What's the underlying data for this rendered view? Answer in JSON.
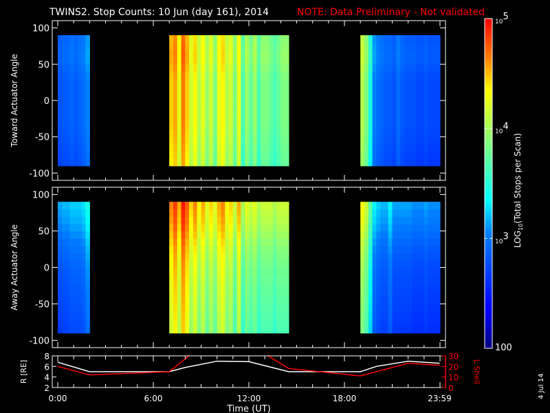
{
  "title": "TWINS2. Stop Counts: 10 Jun (day 161), 2014",
  "note": "NOTE: Data Preliminary - Not validated",
  "date_stamp": "4 Jul 14",
  "colors": {
    "note": "#ff0000",
    "axis": "#ffffff",
    "lshell": "#ff0000",
    "radius": "#ffffff"
  },
  "chart_data": [
    {
      "type": "heatmap",
      "name": "toward",
      "ylabel": "Toward Actuator Angle",
      "ylim": [
        -110,
        110
      ],
      "yticks": [
        "100",
        "50",
        "0",
        "-50",
        "-100"
      ],
      "ytick_values": [
        100,
        50,
        0,
        -50,
        -100
      ],
      "angle_range": [
        -90,
        90
      ],
      "xlim_hours": [
        0,
        24
      ],
      "segments": [
        {
          "start": 0.0,
          "step": 0.25,
          "log10_counts": [
            2.85,
            2.9,
            2.9,
            2.95,
            2.9,
            2.95,
            3.0,
            3.1
          ]
        },
        {
          "start": 7.0,
          "step": 0.25,
          "log10_counts": [
            4.5,
            4.6,
            4.3,
            4.7,
            4.5,
            4.2,
            4.4,
            4.1,
            4.3,
            4.0,
            4.2,
            3.9,
            4.3,
            4.4,
            4.1,
            4.2,
            3.9,
            4.3,
            3.7,
            4.0,
            3.8,
            4.0,
            3.7,
            3.9,
            3.9,
            3.8,
            3.7,
            3.8,
            3.9,
            3.9
          ]
        },
        {
          "start": 19.0,
          "step": 0.25,
          "log10_counts": [
            4.1,
            3.9,
            3.5,
            3.1,
            3.0,
            2.95,
            2.9,
            2.9,
            2.85,
            3.0,
            2.9,
            2.85,
            2.85,
            2.85,
            2.8,
            2.8,
            2.85,
            2.8,
            2.8,
            2.8
          ]
        }
      ],
      "angle_modifier": {
        "angles": [
          -90,
          -60,
          -30,
          0,
          30,
          60,
          90
        ],
        "delta_log10": [
          -0.15,
          -0.1,
          -0.05,
          -0.05,
          -0.05,
          0.05,
          0.0
        ]
      }
    },
    {
      "type": "heatmap",
      "name": "away",
      "ylabel": "Away Actuator Angle",
      "ylim": [
        -110,
        110
      ],
      "yticks": [
        "100",
        "50",
        "0",
        "-50",
        "-100"
      ],
      "ytick_values": [
        100,
        50,
        0,
        -50,
        -100
      ],
      "angle_range": [
        -90,
        90
      ],
      "xlim_hours": [
        0,
        24
      ],
      "segments": [
        {
          "start": 0.0,
          "step": 0.25,
          "log10_counts": [
            2.8,
            2.85,
            2.85,
            2.9,
            2.9,
            2.9,
            2.95,
            3.1
          ]
        },
        {
          "start": 7.0,
          "step": 0.25,
          "log10_counts": [
            4.3,
            4.5,
            4.2,
            4.6,
            4.4,
            4.1,
            4.3,
            4.0,
            4.2,
            3.9,
            4.1,
            3.9,
            4.2,
            4.3,
            4.0,
            4.1,
            3.8,
            4.2,
            3.7,
            3.9,
            3.8,
            3.9,
            3.7,
            3.8,
            3.8,
            3.8,
            3.7,
            3.8,
            3.8,
            3.8
          ]
        },
        {
          "start": 19.0,
          "step": 0.25,
          "log10_counts": [
            4.0,
            3.8,
            3.4,
            3.0,
            2.9,
            2.85,
            2.85,
            3.0,
            2.8,
            2.8,
            2.8,
            2.8,
            2.8,
            2.75,
            2.75,
            2.75,
            2.8,
            2.75,
            2.75,
            2.75
          ]
        }
      ],
      "angle_modifier": {
        "angles": [
          -90,
          -60,
          -30,
          0,
          30,
          60,
          90
        ],
        "delta_log10": [
          -0.15,
          -0.1,
          -0.05,
          0.0,
          0.1,
          0.25,
          0.35
        ]
      }
    },
    {
      "type": "line",
      "name": "orbit",
      "ylabel_left": "R [RE]",
      "ylabel_right": "L Shell",
      "ylim_left": [
        2,
        8
      ],
      "ylim_right": [
        0,
        30
      ],
      "yticks_left": [
        "8",
        "6",
        "4",
        "2"
      ],
      "ytick_values_left": [
        8,
        6,
        4,
        2
      ],
      "yticks_right": [
        "30",
        "20",
        "10",
        "0"
      ],
      "ytick_values_right": [
        30,
        20,
        10,
        0
      ],
      "xlabel": "Time (UT)",
      "xticks": [
        "0:00",
        "6:00",
        "12:00",
        "18:00",
        "23:59"
      ],
      "xtick_hours": [
        0,
        6,
        12,
        18,
        23.98
      ],
      "series": [
        {
          "name": "R",
          "axis": "left",
          "x": [
            0,
            2,
            7,
            8,
            10,
            12,
            14.5,
            19,
            20,
            22,
            23.98
          ],
          "y": [
            6.8,
            5.0,
            5.0,
            5.8,
            7.0,
            6.9,
            5.0,
            5.0,
            6.0,
            7.0,
            6.6
          ]
        },
        {
          "name": "L Shell",
          "axis": "right",
          "x": [
            0,
            2,
            7,
            8.4,
            13,
            14.5,
            19,
            20,
            22,
            23.98
          ],
          "y": [
            20,
            12,
            15,
            32,
            32,
            18,
            11,
            15,
            23,
            21
          ]
        }
      ]
    }
  ],
  "colorbar": {
    "label": "LOG10(Total Stops per Scan)",
    "label_main": "LOG",
    "label_sub": "10",
    "label_rest": "(Total Stops per Scan)",
    "range_log10": [
      2,
      5
    ],
    "ticks": [
      {
        "value": 5,
        "base": "10",
        "exp": "5"
      },
      {
        "value": 4,
        "base": "10",
        "exp": "4"
      },
      {
        "value": 3,
        "base": "10",
        "exp": "3"
      },
      {
        "value": 2,
        "base": "100",
        "exp": ""
      }
    ]
  }
}
